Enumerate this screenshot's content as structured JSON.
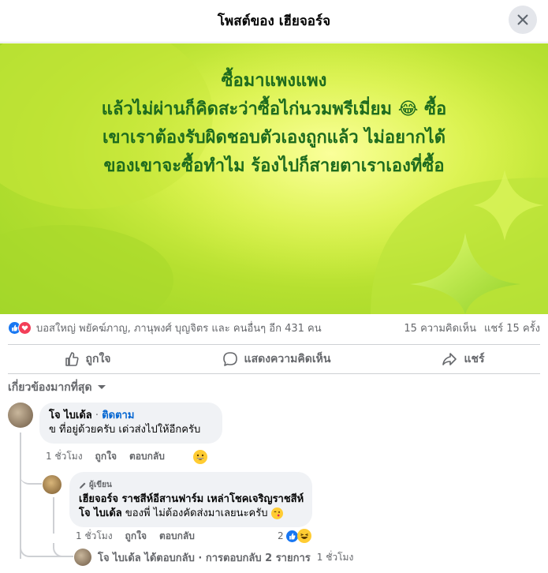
{
  "header": {
    "title": "โพสต์ของ เฮียจอร์จ"
  },
  "post": {
    "lines": [
      "ซื้อมาแพงแพง",
      "แล้วไม่ผ่านก็คิดสะว่าซื้อไก่นวมพรีเมี่ยม 😂 ซื้อ",
      "เขาเราต้องรับผิดชอบตัวเองถูกแล้ว ไม่อยากได้",
      "ของเขาจะซื้อทำไม ร้องไปก็สายตาเราเองที่ซื้อ"
    ]
  },
  "stats": {
    "reactors": "บอสใหญ่ พยัคฆ์ภาญ, ภานุพงศ์ บุญจิตร และ คนอื่นๆ อีก 431 คน",
    "comments": "15 ความคิดเห็น",
    "shares": "แชร์ 15 ครั้ง"
  },
  "actions": {
    "like": "ถูกใจ",
    "comment": "แสดงความคิดเห็น",
    "share": "แชร์"
  },
  "filter": {
    "label": "เกี่ยวข้องมากที่สุด"
  },
  "comment1": {
    "name": "โจ ไบเด้ล",
    "follow": "ติดตาม",
    "text": "ข ที่อยู่ด้วยครับ เด่วส่งไปให้อีกครับ",
    "time": "1 ชั่วโมง",
    "like": "ถูกใจ",
    "reply": "ตอบกลับ"
  },
  "reply1": {
    "badge": "ผู้เขียน",
    "name": "เฮียจอร์จ ราชสีห์อีสานฟาร์ม เหล่าโชคเจริญราชสีห์",
    "mention": "โจ ไบเด้ล",
    "text": " ของพี่ ไม่ต้องคัดส่งมาเลยนะครับ",
    "time": "1 ชั่วโมง",
    "like": "ถูกใจ",
    "reply": "ตอบกลับ",
    "reaction_count": "2"
  },
  "more_replies": {
    "text": "โจ ไบเด้ล ได้ตอบกลับ · การตอบกลับ 2 รายการ",
    "time": "1 ชั่วโมง"
  },
  "colors": {
    "accent": "#1877f2",
    "love": "#f33e58",
    "post_text": "#1e6b1e"
  }
}
